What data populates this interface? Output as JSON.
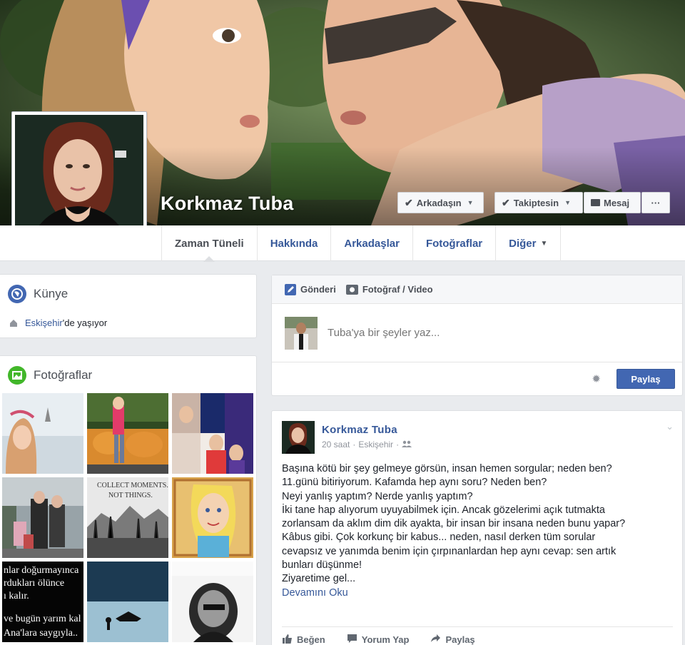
{
  "profile": {
    "name": "Korkmaz Tuba"
  },
  "cover_buttons": {
    "friends": "Arkadaşın",
    "following": "Takiptesin",
    "message": "Mesaj",
    "more": "···"
  },
  "nav": {
    "tabs": [
      "Zaman Tüneli",
      "Hakkında",
      "Arkadaşlar",
      "Fotoğraflar",
      "Diğer"
    ]
  },
  "intro": {
    "title": "Künye",
    "city_link": "Eskişehir",
    "city_suffix": "'de yaşıyor"
  },
  "photos": {
    "title": "Fotoğraflar",
    "tile_texts": {
      "collect_line1": "COLLECT MOMENTS.",
      "collect_line2": "NOT THINGS.",
      "quote_line1": "nlar doğurmayınca",
      "quote_line2": "rdukları ölünce",
      "quote_line3": "ı kalır.",
      "quote_line4": "ve bugün yarım kal",
      "quote_line5": "Ana'lara saygıyla.."
    }
  },
  "composer": {
    "tab_post": "Gönderi",
    "tab_photo": "Fotoğraf / Video",
    "placeholder": "Tuba'ya bir şeyler yaz...",
    "share": "Paylaş"
  },
  "post": {
    "author": "Korkmaz Tuba",
    "time": "20 saat",
    "location": "Eskişehir",
    "lines": [
      "Başına kötü bir şey gelmeye görsün, insan hemen sorgular; neden ben?",
      "11.günü bitiriyorum. Kafamda hep aynı soru? Neden ben?",
      "Neyi yanlış yaptım? Nerde yanlış yaptım?",
      "İki tane hap alıyorum uyuyabilmek için. Ancak gözelerimi açık tutmakta",
      "zorlansam da aklım dim dik ayakta, bir insan bir insana neden bunu yapar?",
      "Kâbus gibi. Çok korkunç bir kabus... neden, nasıl derken tüm sorular",
      "cevapsız ve yanımda benim için çırpınanlardan hep aynı cevap: sen artık",
      "bunları düşünme!",
      "Ziyaretime gel..."
    ],
    "see_more": "Devamını Oku",
    "actions": {
      "like": "Beğen",
      "comment": "Yorum Yap",
      "share": "Paylaş"
    }
  }
}
